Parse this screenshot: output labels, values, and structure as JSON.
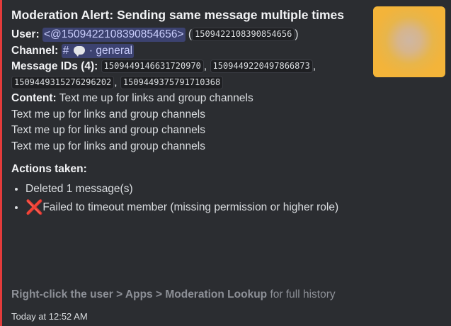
{
  "embed": {
    "accent_color": "#e23b3b",
    "title": "Moderation Alert: Sending same message multiple times",
    "user_label": "User:",
    "user_mention": "<@1509422108390854656>",
    "user_id_open": "(",
    "user_id": "1509422108390854656",
    "user_id_close": ")",
    "channel_label": "Channel:",
    "channel_hash": "#",
    "channel_sep": "·",
    "channel_name": "general",
    "channel_icon": "speech-bubble-icon",
    "message_ids_label": "Message IDs (4):",
    "message_ids": [
      "1509449146631720970",
      "1509449220497866873",
      "1509449315276296202",
      "1509449375791710368"
    ],
    "comma": ",",
    "content_label": "Content:",
    "content_lines": [
      "Text me up for links and group channels",
      "Text me up for links and group channels",
      "Text me up for links and group channels",
      "Text me up for links and group channels"
    ],
    "actions_label": "Actions taken:",
    "actions": [
      {
        "icon": "",
        "text": "Deleted 1 message(s)"
      },
      {
        "icon": "cross-mark-icon",
        "glyph": "❌",
        "text": "Failed to timeout member (missing permission or higher role)"
      }
    ],
    "footer_tip_bold": "Right-click the user > Apps > Moderation Lookup",
    "footer_tip_rest": " for full history",
    "timestamp": "Today at 12:52 AM"
  }
}
